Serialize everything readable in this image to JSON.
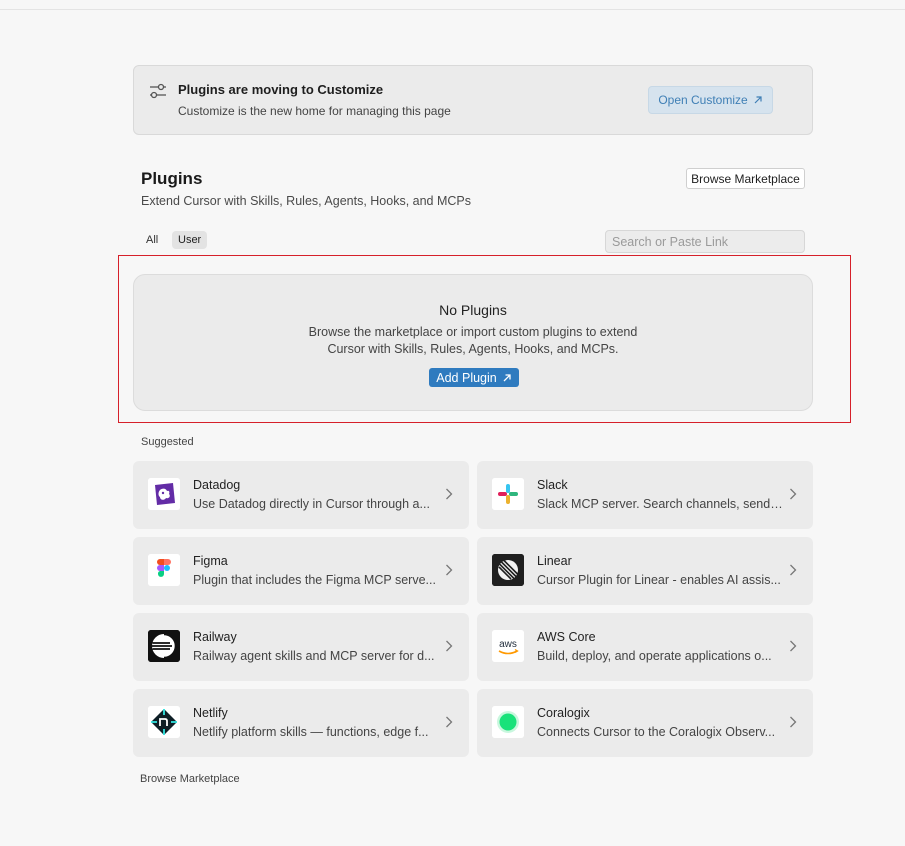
{
  "banner": {
    "title": "Plugins are moving to Customize",
    "subtitle": "Customize is the new home for managing this page",
    "button_label": "Open Customize"
  },
  "header": {
    "title": "Plugins",
    "subtitle": "Extend Cursor with Skills, Rules, Agents, Hooks, and MCPs",
    "browse_button": "Browse Marketplace"
  },
  "filters": {
    "tabs": [
      {
        "label": "All",
        "active": false
      },
      {
        "label": "User",
        "active": true
      }
    ],
    "search_placeholder": "Search or Paste Link"
  },
  "empty_state": {
    "title": "No Plugins",
    "line1": "Browse the marketplace or import custom plugins to extend",
    "line2": "Cursor with Skills, Rules, Agents, Hooks, and MCPs.",
    "button_label": "Add Plugin"
  },
  "suggested": {
    "label": "Suggested",
    "items": [
      {
        "name": "Datadog",
        "description": "Use Datadog directly in Cursor through a...",
        "icon": "datadog-icon"
      },
      {
        "name": "Slack",
        "description": "Slack MCP server. Search channels, send ...",
        "icon": "slack-icon"
      },
      {
        "name": "Figma",
        "description": "Plugin that includes the Figma MCP serve...",
        "icon": "figma-icon"
      },
      {
        "name": "Linear",
        "description": "Cursor Plugin for Linear - enables AI assis...",
        "icon": "linear-icon"
      },
      {
        "name": "Railway",
        "description": "Railway agent skills and MCP server for d...",
        "icon": "railway-icon"
      },
      {
        "name": "AWS Core",
        "description": "Build, deploy, and operate applications o...",
        "icon": "aws-icon"
      },
      {
        "name": "Netlify",
        "description": "Netlify platform skills — functions, edge f...",
        "icon": "netlify-icon"
      },
      {
        "name": "Coralogix",
        "description": "Connects Cursor to the Coralogix Observ...",
        "icon": "coralogix-icon"
      }
    ]
  },
  "footer": {
    "browse_link": "Browse Marketplace"
  },
  "colors": {
    "accent": "#2f7bbf",
    "highlight_border": "#d6202a",
    "card_bg": "#ebebeb"
  }
}
